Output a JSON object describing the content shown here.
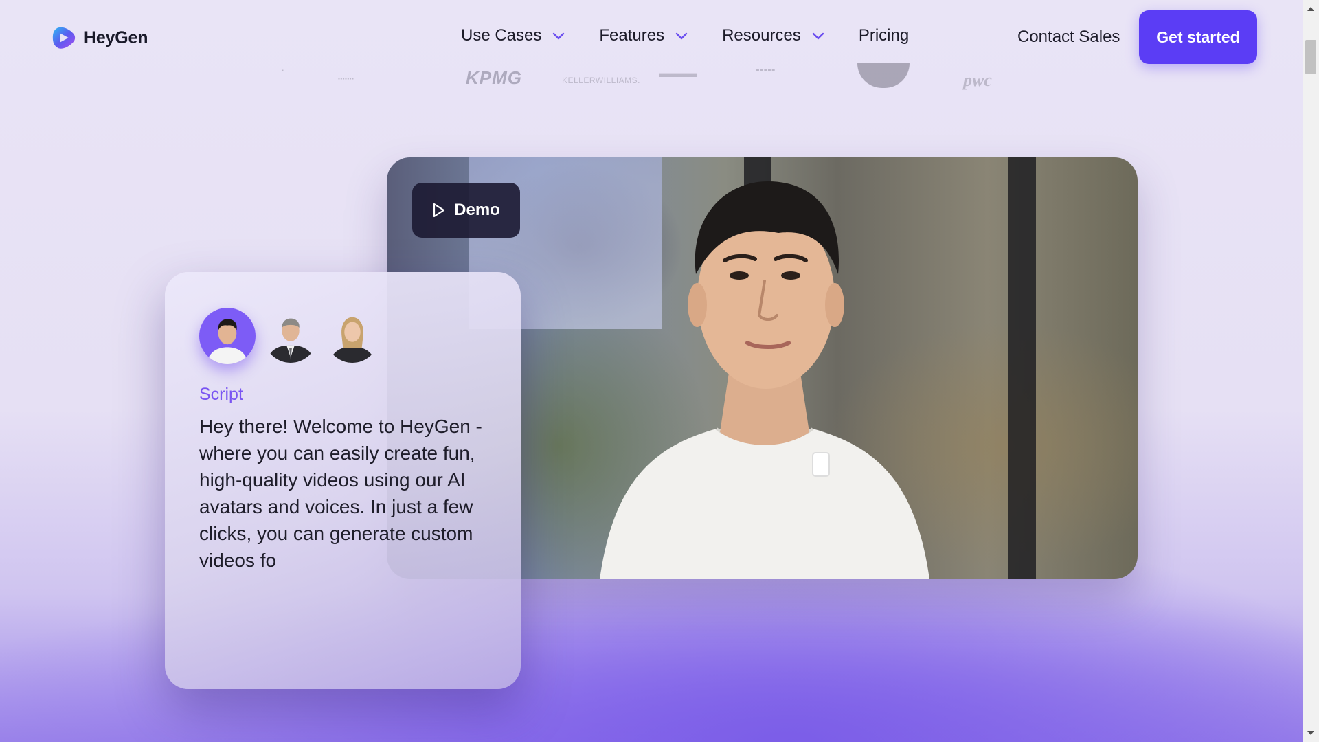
{
  "brand": {
    "name": "HeyGen",
    "accent": "#5b3df5"
  },
  "nav": {
    "items": [
      {
        "label": "Use Cases",
        "dropdown": true
      },
      {
        "label": "Features",
        "dropdown": true
      },
      {
        "label": "Resources",
        "dropdown": true
      },
      {
        "label": "Pricing",
        "dropdown": false
      }
    ],
    "contact_label": "Contact Sales",
    "cta_label": "Get started"
  },
  "logos": [
    "KPMG",
    "KELLERWILLIAMS.",
    "pwc"
  ],
  "video": {
    "demo_label": "Demo"
  },
  "script_card": {
    "label": "Script",
    "text": "Hey there! Welcome to HeyGen - where you can easily create fun, high-quality videos using our AI avatars and voices. In just a few clicks, you can generate custom videos fo"
  }
}
